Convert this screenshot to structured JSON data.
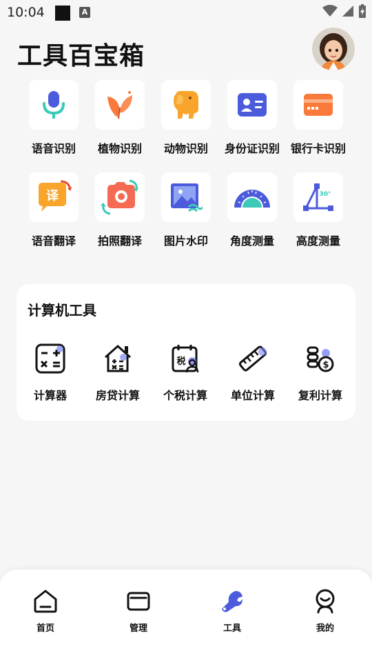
{
  "status_bar": {
    "time": "10:04",
    "a_glyph": "A",
    "icons": [
      "notification-square-icon",
      "a-app-icon",
      "wifi-icon",
      "signal-icon",
      "battery-charging-icon"
    ]
  },
  "header": {
    "title": "工具百宝箱",
    "avatar": "avatar-girl"
  },
  "tools": [
    {
      "label": "语音识别",
      "icon": "microphone-icon"
    },
    {
      "label": "植物识别",
      "icon": "plant-icon"
    },
    {
      "label": "动物识别",
      "icon": "elephant-icon"
    },
    {
      "label": "身份证识别",
      "icon": "id-card-icon"
    },
    {
      "label": "银行卡识别",
      "icon": "bank-card-icon"
    },
    {
      "label": "语音翻译",
      "icon": "voice-translate-icon",
      "glyph": "译"
    },
    {
      "label": "拍照翻译",
      "icon": "camera-translate-icon"
    },
    {
      "label": "图片水印",
      "icon": "image-watermark-icon"
    },
    {
      "label": "角度测量",
      "icon": "protractor-icon"
    },
    {
      "label": "高度测量",
      "icon": "height-measure-icon",
      "glyph": "30°"
    }
  ],
  "calculator_card": {
    "title": "计算机工具",
    "items": [
      {
        "label": "计算器",
        "icon": "calculator-icon"
      },
      {
        "label": "房贷计算",
        "icon": "house-loan-icon"
      },
      {
        "label": "个税计算",
        "icon": "tax-icon",
        "glyph": "税"
      },
      {
        "label": "单位计算",
        "icon": "ruler-icon"
      },
      {
        "label": "复利计算",
        "icon": "coins-icon"
      }
    ]
  },
  "bottom_nav": [
    {
      "label": "首页",
      "icon": "home-icon",
      "active": false
    },
    {
      "label": "管理",
      "icon": "folder-icon",
      "active": false
    },
    {
      "label": "工具",
      "icon": "wrench-icon",
      "active": true
    },
    {
      "label": "我的",
      "icon": "profile-icon",
      "active": false
    }
  ],
  "colors": {
    "background": "#f6f6f6",
    "accent_blue": "#4b5bdc",
    "orange": "#f97a3a",
    "teal": "#3cc9b8"
  }
}
